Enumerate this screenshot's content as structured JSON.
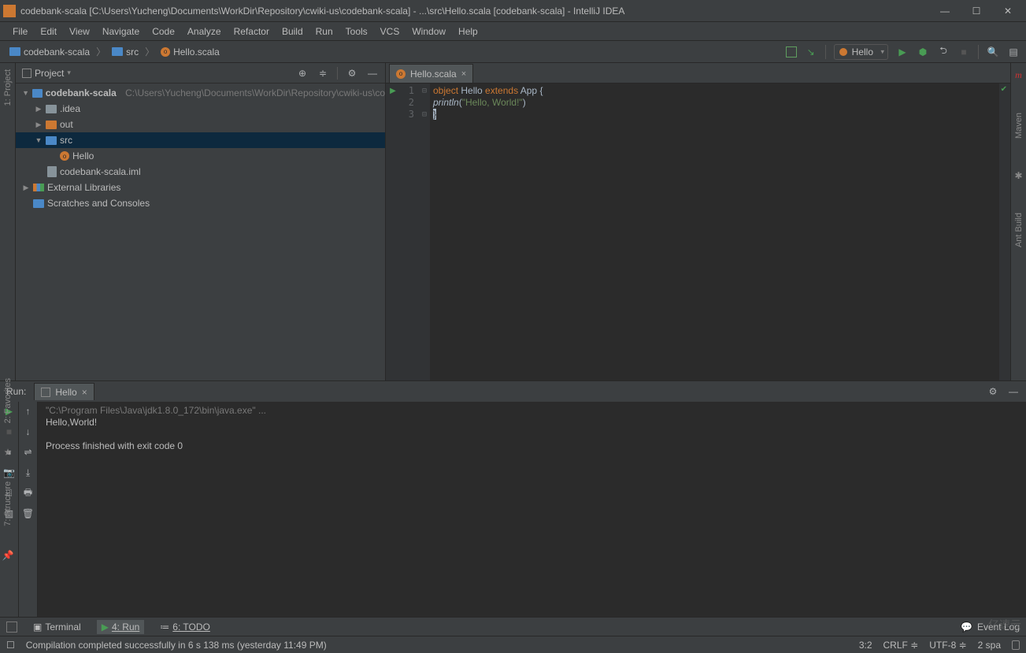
{
  "window": {
    "title": "codebank-scala [C:\\Users\\Yucheng\\Documents\\WorkDir\\Repository\\cwiki-us\\codebank-scala] - ...\\src\\Hello.scala [codebank-scala] - IntelliJ IDEA"
  },
  "menu": [
    "File",
    "Edit",
    "View",
    "Navigate",
    "Code",
    "Analyze",
    "Refactor",
    "Build",
    "Run",
    "Tools",
    "VCS",
    "Window",
    "Help"
  ],
  "breadcrumb": [
    {
      "icon": "folder-blue",
      "label": "codebank-scala"
    },
    {
      "icon": "folder-blue",
      "label": "src"
    },
    {
      "icon": "scala",
      "label": "Hello.scala"
    }
  ],
  "run_config": "Hello",
  "project": {
    "title": "Project",
    "tree": {
      "root_name": "codebank-scala",
      "root_path": "C:\\Users\\Yucheng\\Documents\\WorkDir\\Repository\\cwiki-us\\co",
      "idea": ".idea",
      "out": "out",
      "src": "src",
      "hello": "Hello",
      "iml": "codebank-scala.iml",
      "ext": "External Libraries",
      "scratch": "Scratches and Consoles"
    }
  },
  "editor": {
    "tab": "Hello.scala",
    "lines": {
      "l1_kw": "object",
      "l1_name": " Hello ",
      "l1_ext": "extends",
      "l1_app": " App ",
      "l1_brace": "{",
      "l2_indent": "    ",
      "l2_fn": "println",
      "l2_open": "(",
      "l2_str": "\"Hello, World!\"",
      "l2_close": ")",
      "l3": "}"
    }
  },
  "run": {
    "label": "Run:",
    "tab": "Hello",
    "cmd": "\"C:\\Program Files\\Java\\jdk1.8.0_172\\bin\\java.exe\" ...",
    "out": "Hello,World!",
    "blank": "",
    "exit": "Process finished with exit code 0"
  },
  "bottom": {
    "terminal": "Terminal",
    "run": "4: Run",
    "todo": "6: TODO",
    "eventlog": "Event Log"
  },
  "status": {
    "msg": "Compilation completed successfully in 6 s 138 ms (yesterday 11:49 PM)",
    "pos": "3:2",
    "crlf": "CRLF",
    "enc": "UTF-8",
    "indent": "2 spa"
  },
  "gutters": {
    "left_project": "1: Project",
    "left_fav": "2: Favorites",
    "left_struct": "7: Structure",
    "right_maven": "Maven",
    "right_ant": "Ant Build"
  },
  "watermark": "亿速云"
}
